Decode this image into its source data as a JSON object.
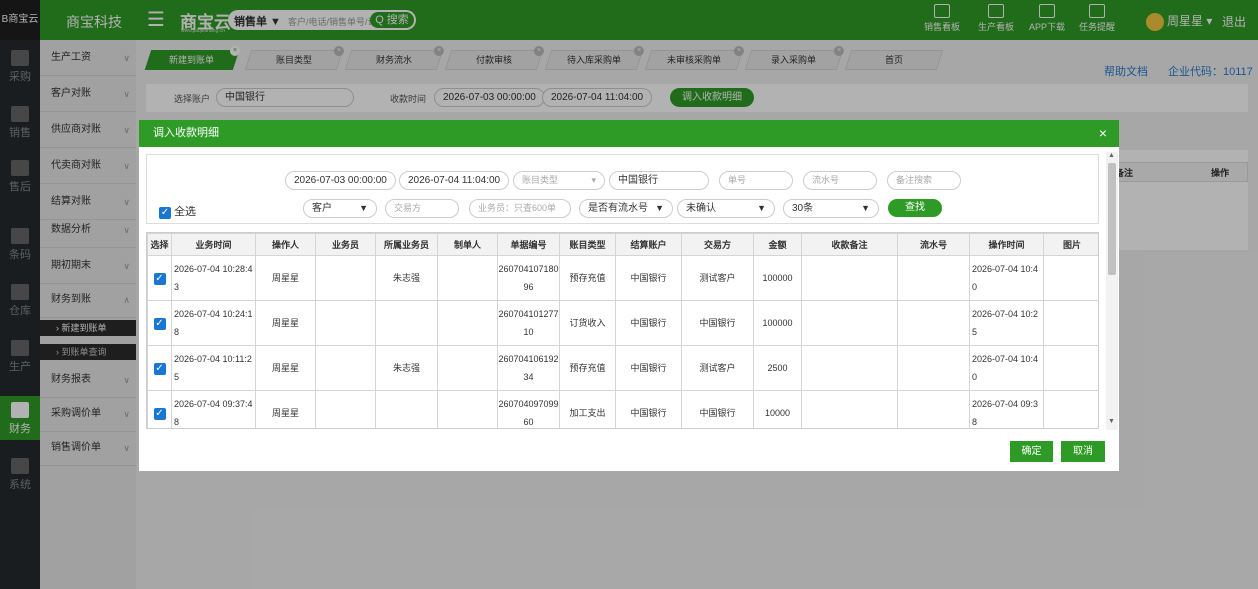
{
  "topbar": {
    "logo_text": "B商宝云",
    "company": "商宝科技",
    "brand": "商宝云",
    "brand_sub": "www.jiaqieshang.cn",
    "search_type": "销售单 ▼",
    "search_placeholder": "客户/电话/销售单号/订单号",
    "search_button": "Q 搜索",
    "nav": [
      "销售看板",
      "生产看板",
      "APP下载",
      "任务提醒"
    ],
    "user": "周星星 ▾",
    "logout": "退出"
  },
  "leftnav": [
    {
      "label": "采购",
      "icon": "cart-icon"
    },
    {
      "label": "销售",
      "icon": "sales-icon"
    },
    {
      "label": "售后",
      "icon": "aftersale-icon"
    },
    {
      "label": "条码",
      "icon": "barcode-icon"
    },
    {
      "label": "仓库",
      "icon": "warehouse-icon"
    },
    {
      "label": "生产",
      "icon": "production-icon"
    },
    {
      "label": "财务",
      "icon": "finance-icon",
      "active": true
    },
    {
      "label": "系统",
      "icon": "gear-icon"
    }
  ],
  "sidebar": {
    "items": [
      "生产工资",
      "客户对账",
      "供应商对账",
      "代卖商对账",
      "结算对账",
      "数据分析",
      "期初期末",
      "财务到账",
      "财务报表",
      "采购调价单",
      "销售调价单"
    ],
    "subitems": [
      "› 新建到账单",
      "› 到账单查询"
    ]
  },
  "tabs": [
    "新建到账单",
    "账目类型",
    "财务流水",
    "付款审核",
    "待入库采购单",
    "未审核采购单",
    "录入采购单",
    "首页"
  ],
  "header_links": {
    "help": "帮助文档",
    "enterprise": "企业代码：10117"
  },
  "filterrow": {
    "account_label": "选择账户",
    "account_value": "中国银行",
    "time_label": "收款时间",
    "start": "2026-07-03 00:00:00",
    "end": "2026-07-04 11:04:00",
    "button": "调入收款明细"
  },
  "right_table": {
    "headers": [
      "备注",
      "操作"
    ]
  },
  "modal": {
    "title": "调入收款明细",
    "close": "×",
    "filters": {
      "start": "2026-07-03 00:00:00",
      "end": "2026-07-04 11:04:00",
      "account_type_ph": "账目类型",
      "account": "中国银行",
      "order_ph": "单号",
      "serial_ph": "流水号",
      "remark_ph": "备注搜索",
      "select_all": "全选",
      "customer": "客户",
      "counterparty_ph": "交易方",
      "salesman_ph": "业务员：只查600单",
      "has_serial": "是否有流水号",
      "status": "未确认",
      "count": "30条",
      "find": "查找"
    },
    "columns": [
      "选择",
      "业务时间",
      "操作人",
      "业务员",
      "所属业务员",
      "制单人",
      "单据编号",
      "账目类型",
      "结算账户",
      "交易方",
      "金额",
      "收款备注",
      "流水号",
      "操作时间",
      "图片"
    ],
    "rows": [
      {
        "time": "2026-07-04 10:28:43",
        "operator": "周星星",
        "salesman": "",
        "owner": "朱志强",
        "maker": "",
        "no": "26070410718096",
        "type": "预存充值",
        "account": "中国银行",
        "party": "测试客户",
        "amount": "100000",
        "remark": "",
        "serial": "",
        "optime": "2026-07-04 10:40",
        "img": ""
      },
      {
        "time": "2026-07-04 10:24:18",
        "operator": "周星星",
        "salesman": "",
        "owner": "",
        "maker": "",
        "no": "26070410127710",
        "type": "订货收入",
        "account": "中国银行",
        "party": "中国银行",
        "amount": "100000",
        "remark": "",
        "serial": "",
        "optime": "2026-07-04 10:25",
        "img": ""
      },
      {
        "time": "2026-07-04 10:11:25",
        "operator": "周星星",
        "salesman": "",
        "owner": "朱志强",
        "maker": "",
        "no": "26070410619234",
        "type": "预存充值",
        "account": "中国银行",
        "party": "测试客户",
        "amount": "2500",
        "remark": "",
        "serial": "",
        "optime": "2026-07-04 10:40",
        "img": ""
      },
      {
        "time": "2026-07-04 09:37:48",
        "operator": "周星星",
        "salesman": "",
        "owner": "",
        "maker": "",
        "no": "26070409709960",
        "type": "加工支出",
        "account": "中国银行",
        "party": "中国银行",
        "amount": "10000",
        "remark": "",
        "serial": "",
        "optime": "2026-07-04 09:38",
        "img": ""
      }
    ],
    "ok": "确定",
    "cancel": "取消"
  }
}
